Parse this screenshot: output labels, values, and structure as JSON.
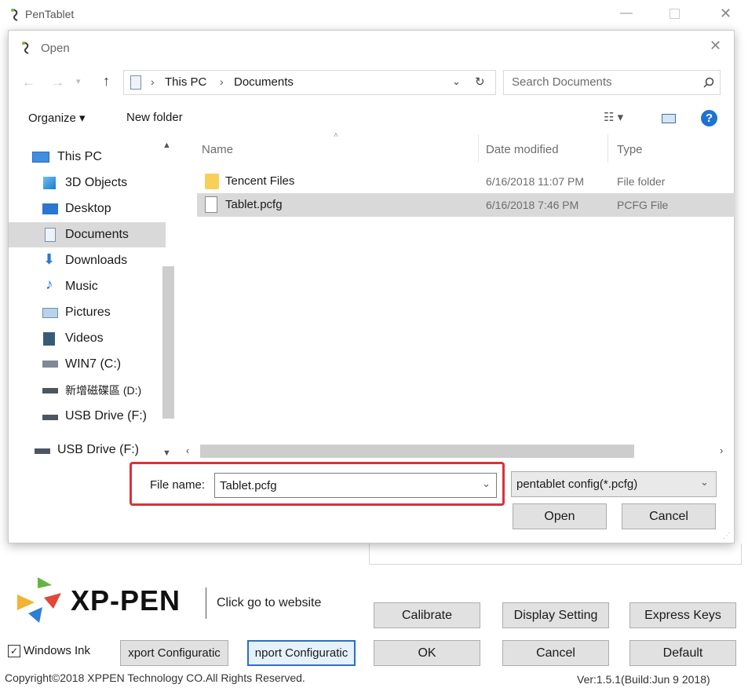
{
  "app": {
    "title": "PenTablet"
  },
  "dialog": {
    "title": "Open",
    "breadcrumb": [
      "This PC",
      "Documents"
    ],
    "search_placeholder": "Search Documents",
    "toolbar": {
      "organize": "Organize ▾",
      "new_folder": "New folder"
    },
    "nav_items": [
      {
        "label": "This PC",
        "icon": "computer-icon"
      },
      {
        "label": "3D Objects",
        "icon": "cube-icon"
      },
      {
        "label": "Desktop",
        "icon": "desktop-icon"
      },
      {
        "label": "Documents",
        "icon": "document-icon",
        "selected": true
      },
      {
        "label": "Downloads",
        "icon": "download-arrow-icon"
      },
      {
        "label": "Music",
        "icon": "music-note-icon"
      },
      {
        "label": "Pictures",
        "icon": "pictures-icon"
      },
      {
        "label": "Videos",
        "icon": "video-icon"
      },
      {
        "label": "WIN7 (C:)",
        "icon": "drive-icon"
      },
      {
        "label": "新增磁碟區 (D:)",
        "icon": "drive-icon"
      },
      {
        "label": "USB Drive (F:)",
        "icon": "usb-drive-icon"
      },
      {
        "label": "USB Drive (F:)",
        "icon": "usb-drive-icon"
      }
    ],
    "columns": {
      "name": "Name",
      "date": "Date modified",
      "type": "Type"
    },
    "files": [
      {
        "name": "Tencent Files",
        "date": "6/16/2018 11:07 PM",
        "type": "File folder",
        "icon": "folder-icon"
      },
      {
        "name": "Tablet.pcfg",
        "date": "6/16/2018 7:46 PM",
        "type": "PCFG File",
        "icon": "file-icon",
        "selected": true
      }
    ],
    "filename_label": "File name:",
    "filename_value": "Tablet.pcfg",
    "filetype": "pentablet config(*.pcfg)",
    "open_label": "Open",
    "cancel_label": "Cancel",
    "highlight_color": "#d9323a"
  },
  "background": {
    "logo_text": "XP-PEN",
    "website_text": "Click go to website",
    "buttons": {
      "calibrate": "Calibrate",
      "display_setting": "Display Setting",
      "express_keys": "Express Keys",
      "ok": "OK",
      "cancel": "Cancel",
      "default": "Default",
      "export": "xport Configuratic",
      "import": "nport Configuratic"
    },
    "windows_ink": "Windows Ink",
    "copyright": "Copyright©2018  XPPEN Technology CO.All Rights Reserved.",
    "version": "Ver:1.5.1(Build:Jun  9 2018)"
  }
}
